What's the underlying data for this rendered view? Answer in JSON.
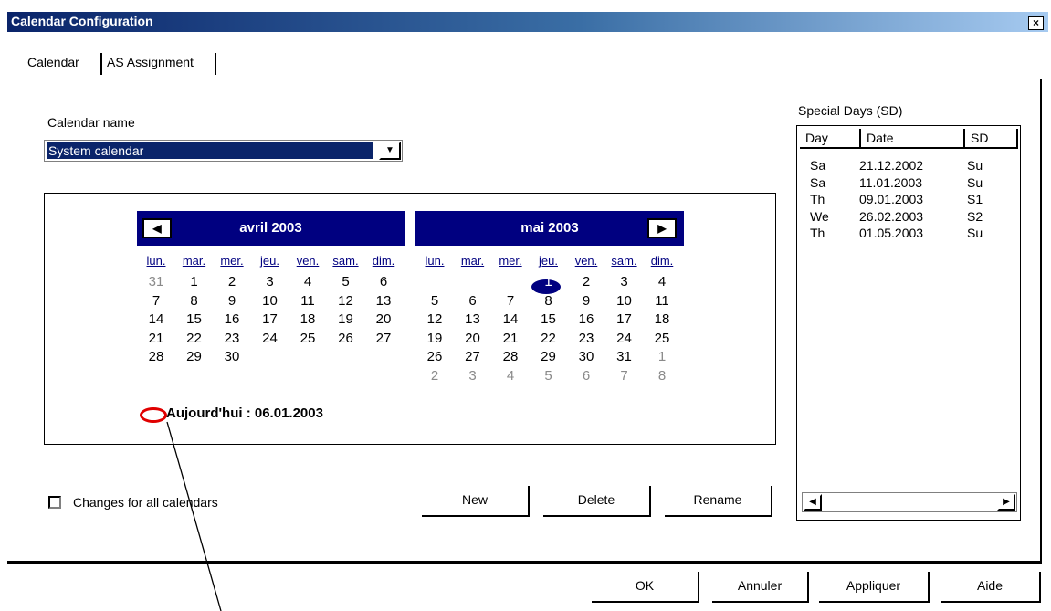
{
  "window": {
    "title": "Calendar Configuration",
    "close_label": "×"
  },
  "tabs": [
    {
      "label": "Calendar"
    },
    {
      "label": "AS Assignment"
    }
  ],
  "calendar_name": {
    "label": "Calendar name",
    "value": "System calendar"
  },
  "months": [
    {
      "title": "avril 2003",
      "dow": [
        "lun.",
        "mar.",
        "mer.",
        "jeu.",
        "ven.",
        "sam.",
        "dim."
      ],
      "weeks": [
        [
          "31",
          "1",
          "2",
          "3",
          "4",
          "5",
          "6"
        ],
        [
          "7",
          "8",
          "9",
          "10",
          "11",
          "12",
          "13"
        ],
        [
          "14",
          "15",
          "16",
          "17",
          "18",
          "19",
          "20"
        ],
        [
          "21",
          "22",
          "23",
          "24",
          "25",
          "26",
          "27"
        ],
        [
          "28",
          "29",
          "30",
          "",
          "",
          "",
          ""
        ]
      ]
    },
    {
      "title": "mai 2003",
      "dow": [
        "lun.",
        "mar.",
        "mer.",
        "jeu.",
        "ven.",
        "sam.",
        "dim."
      ],
      "weeks": [
        [
          "",
          "",
          "",
          "1",
          "2",
          "3",
          "4"
        ],
        [
          "5",
          "6",
          "7",
          "8",
          "9",
          "10",
          "11"
        ],
        [
          "12",
          "13",
          "14",
          "15",
          "16",
          "17",
          "18"
        ],
        [
          "19",
          "20",
          "21",
          "22",
          "23",
          "24",
          "25"
        ],
        [
          "26",
          "27",
          "28",
          "29",
          "30",
          "31",
          "1"
        ],
        [
          "2",
          "3",
          "4",
          "5",
          "6",
          "7",
          "8"
        ]
      ]
    }
  ],
  "today_text": "Aujourd'hui : 06.01.2003",
  "changes_all": {
    "label": "Changes for all calendars",
    "checked": false
  },
  "actions": {
    "new": "New",
    "delete": "Delete",
    "rename": "Rename"
  },
  "special_days": {
    "title": "Special Days (SD)",
    "columns": [
      "Day",
      "Date",
      "SD"
    ],
    "rows": [
      [
        "Sa",
        "21.12.2002",
        "Su"
      ],
      [
        "Sa",
        "11.01.2003",
        "Su"
      ],
      [
        "Th",
        "09.01.2003",
        "S1"
      ],
      [
        "We",
        "26.02.2003",
        "S2"
      ],
      [
        "Th",
        "01.05.2003",
        "Su"
      ]
    ]
  },
  "dialog_buttons": {
    "ok": "OK",
    "cancel": "Annuler",
    "apply": "Appliquer",
    "help": "Aide"
  }
}
